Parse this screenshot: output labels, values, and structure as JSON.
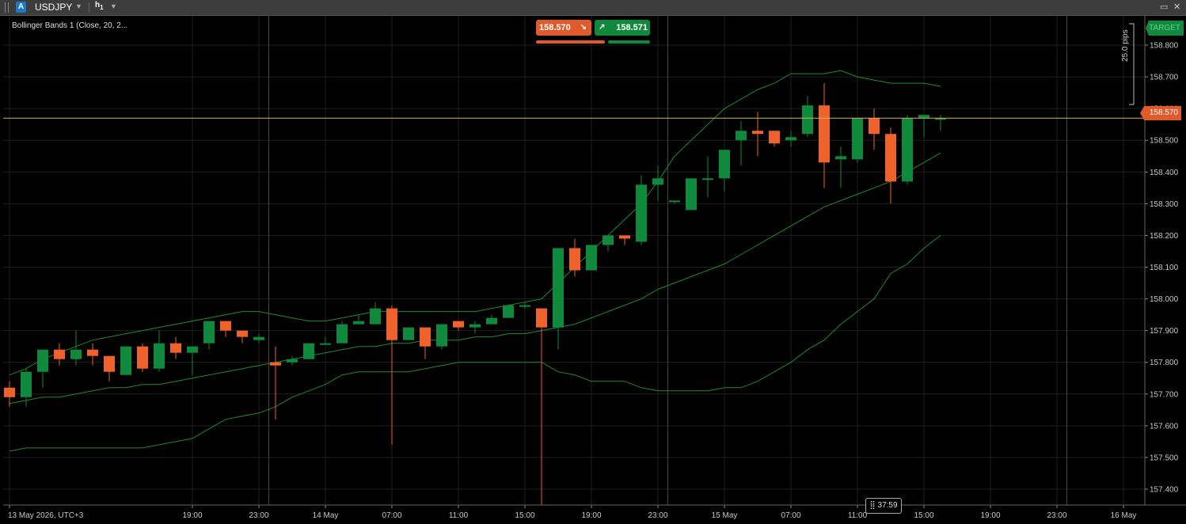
{
  "toolbar": {
    "account_badge": "A",
    "symbol": "USDJPY",
    "timeframe_main": "h",
    "timeframe_sub": "1",
    "dropdown_icon": "chevron-down-icon",
    "restore_icon": "restore-window-icon",
    "close_icon": "close-icon"
  },
  "indicator": {
    "label": "Bollinger Bands 1 (Close, 20, 2..."
  },
  "trade_panel": {
    "sell_price": "158.570",
    "buy_price": "158.571",
    "sell_color": "#e05a2b",
    "buy_color": "#0f8a3c"
  },
  "price_axis": {
    "target_label": "TARGET",
    "current_price_label": "158.570",
    "pips_label": "25.0 pips"
  },
  "timer": {
    "text": "37:59"
  },
  "chart_data": {
    "type": "candlestick",
    "symbol": "USDJPY",
    "timeframe": "H1",
    "ylim": [
      157.35,
      158.86
    ],
    "yticks": [
      157.4,
      157.5,
      157.6,
      157.7,
      157.8,
      157.9,
      158.0,
      158.1,
      158.2,
      158.3,
      158.4,
      158.5,
      158.6,
      158.7,
      158.8
    ],
    "ytick_labels": [
      "157.400",
      "157.500",
      "157.600",
      "157.700",
      "157.800",
      "157.900",
      "158.000",
      "158.100",
      "158.200",
      "158.300",
      "158.400",
      "158.500",
      "158.600",
      "158.700",
      "158.800"
    ],
    "xticks": [
      {
        "index": 0,
        "label": "13 May 2026, UTC+3"
      },
      {
        "index": 11,
        "label": "19:00"
      },
      {
        "index": 15,
        "label": "23:00"
      },
      {
        "index": 19,
        "label": "14 May"
      },
      {
        "index": 23,
        "label": "07:00"
      },
      {
        "index": 27,
        "label": "11:00"
      },
      {
        "index": 31,
        "label": "15:00"
      },
      {
        "index": 35,
        "label": "19:00"
      },
      {
        "index": 39,
        "label": "23:00"
      },
      {
        "index": 43,
        "label": "15 May"
      },
      {
        "index": 47,
        "label": "07:00"
      },
      {
        "index": 51,
        "label": "11:00"
      },
      {
        "index": 55,
        "label": "15:00"
      },
      {
        "index": 59,
        "label": "19:00"
      },
      {
        "index": 63,
        "label": "23:00"
      },
      {
        "index": 67,
        "label": "16 May"
      }
    ],
    "day_separators": [
      16,
      40,
      64
    ],
    "current_price": 158.57,
    "up_color": "#0f8a3c",
    "down_color": "#f0622c",
    "band_color": "#1e8a2e",
    "candles": [
      [
        157.72,
        157.74,
        157.66,
        157.69
      ],
      [
        157.69,
        157.78,
        157.66,
        157.77
      ],
      [
        157.77,
        157.84,
        157.72,
        157.84
      ],
      [
        157.84,
        157.86,
        157.79,
        157.81
      ],
      [
        157.81,
        157.9,
        157.79,
        157.84
      ],
      [
        157.84,
        157.86,
        157.79,
        157.82
      ],
      [
        157.82,
        157.82,
        157.74,
        157.77
      ],
      [
        157.76,
        157.85,
        157.76,
        157.85
      ],
      [
        157.85,
        157.86,
        157.77,
        157.78
      ],
      [
        157.78,
        157.9,
        157.77,
        157.86
      ],
      [
        157.86,
        157.88,
        157.81,
        157.83
      ],
      [
        157.83,
        157.85,
        157.76,
        157.85
      ],
      [
        157.86,
        157.93,
        157.84,
        157.93
      ],
      [
        157.93,
        157.93,
        157.88,
        157.9
      ],
      [
        157.9,
        157.9,
        157.86,
        157.88
      ],
      [
        157.87,
        157.89,
        157.86,
        157.88
      ],
      [
        157.8,
        157.85,
        157.62,
        157.79
      ],
      [
        157.8,
        157.82,
        157.79,
        157.81
      ],
      [
        157.81,
        157.86,
        157.81,
        157.86
      ],
      [
        157.86,
        157.88,
        157.86,
        157.86
      ],
      [
        157.86,
        157.93,
        157.86,
        157.92
      ],
      [
        157.92,
        157.95,
        157.92,
        157.93
      ],
      [
        157.92,
        157.99,
        157.92,
        157.97
      ],
      [
        157.97,
        157.98,
        157.54,
        157.87
      ],
      [
        157.87,
        157.9,
        157.87,
        157.91
      ],
      [
        157.91,
        157.91,
        157.81,
        157.85
      ],
      [
        157.85,
        157.92,
        157.84,
        157.92
      ],
      [
        157.93,
        157.93,
        157.9,
        157.91
      ],
      [
        157.91,
        157.93,
        157.89,
        157.92
      ],
      [
        157.92,
        157.95,
        157.92,
        157.94
      ],
      [
        157.94,
        157.98,
        157.94,
        157.98
      ],
      [
        157.98,
        157.99,
        157.97,
        157.98
      ],
      [
        157.97,
        157.97,
        157.35,
        157.91
      ],
      [
        157.91,
        158.16,
        157.84,
        158.16
      ],
      [
        158.16,
        158.19,
        158.07,
        158.09
      ],
      [
        158.09,
        158.17,
        158.09,
        158.17
      ],
      [
        158.17,
        158.2,
        158.15,
        158.2
      ],
      [
        158.2,
        158.2,
        158.17,
        158.19
      ],
      [
        158.18,
        158.39,
        158.17,
        158.36
      ],
      [
        158.36,
        158.42,
        158.31,
        158.38
      ],
      [
        158.31,
        158.31,
        158.3,
        158.31
      ],
      [
        158.28,
        158.38,
        158.28,
        158.38
      ],
      [
        158.38,
        158.45,
        158.32,
        158.38
      ],
      [
        158.38,
        158.47,
        158.34,
        158.47
      ],
      [
        158.5,
        158.56,
        158.42,
        158.53
      ],
      [
        158.53,
        158.59,
        158.45,
        158.52
      ],
      [
        158.53,
        158.53,
        158.48,
        158.49
      ],
      [
        158.5,
        158.53,
        158.48,
        158.51
      ],
      [
        158.52,
        158.64,
        158.51,
        158.61
      ],
      [
        158.61,
        158.68,
        158.35,
        158.43
      ],
      [
        158.44,
        158.48,
        158.35,
        158.45
      ],
      [
        158.44,
        158.57,
        158.43,
        158.57
      ],
      [
        158.57,
        158.6,
        158.47,
        158.52
      ],
      [
        158.52,
        158.54,
        158.3,
        158.37
      ],
      [
        158.37,
        158.58,
        158.36,
        158.57
      ],
      [
        158.57,
        158.58,
        158.51,
        158.58
      ],
      [
        158.57,
        158.58,
        158.53,
        158.57
      ]
    ],
    "upper_band": [
      157.76,
      157.78,
      157.81,
      157.83,
      157.85,
      157.87,
      157.88,
      157.89,
      157.9,
      157.91,
      157.92,
      157.93,
      157.94,
      157.95,
      157.96,
      157.96,
      157.95,
      157.94,
      157.93,
      157.93,
      157.94,
      157.95,
      157.96,
      157.96,
      157.96,
      157.96,
      157.96,
      157.96,
      157.96,
      157.97,
      157.98,
      157.99,
      158.0,
      158.05,
      158.1,
      158.15,
      158.2,
      158.25,
      158.3,
      158.37,
      158.45,
      158.5,
      158.55,
      158.6,
      158.63,
      158.66,
      158.68,
      158.71,
      158.71,
      158.71,
      158.72,
      158.7,
      158.69,
      158.68,
      158.68,
      158.68,
      158.67
    ],
    "middle_band": [
      157.67,
      157.68,
      157.69,
      157.69,
      157.7,
      157.71,
      157.72,
      157.72,
      157.73,
      157.73,
      157.74,
      157.75,
      157.76,
      157.77,
      157.78,
      157.79,
      157.8,
      157.81,
      157.82,
      157.83,
      157.84,
      157.85,
      157.85,
      157.86,
      157.86,
      157.87,
      157.87,
      157.87,
      157.88,
      157.88,
      157.89,
      157.89,
      157.9,
      157.91,
      157.92,
      157.94,
      157.96,
      157.98,
      158.0,
      158.03,
      158.05,
      158.07,
      158.09,
      158.11,
      158.14,
      158.17,
      158.2,
      158.23,
      158.26,
      158.29,
      158.31,
      158.33,
      158.35,
      158.37,
      158.4,
      158.43,
      158.46
    ],
    "lower_band": [
      157.52,
      157.53,
      157.53,
      157.53,
      157.53,
      157.53,
      157.53,
      157.53,
      157.53,
      157.54,
      157.55,
      157.56,
      157.59,
      157.62,
      157.63,
      157.64,
      157.66,
      157.69,
      157.71,
      157.73,
      157.76,
      157.77,
      157.77,
      157.77,
      157.77,
      157.78,
      157.79,
      157.8,
      157.8,
      157.8,
      157.8,
      157.8,
      157.8,
      157.77,
      157.76,
      157.74,
      157.74,
      157.74,
      157.72,
      157.71,
      157.71,
      157.71,
      157.71,
      157.72,
      157.72,
      157.74,
      157.77,
      157.8,
      157.84,
      157.87,
      157.92,
      157.96,
      158.0,
      158.08,
      158.11,
      158.16,
      158.2
    ]
  }
}
